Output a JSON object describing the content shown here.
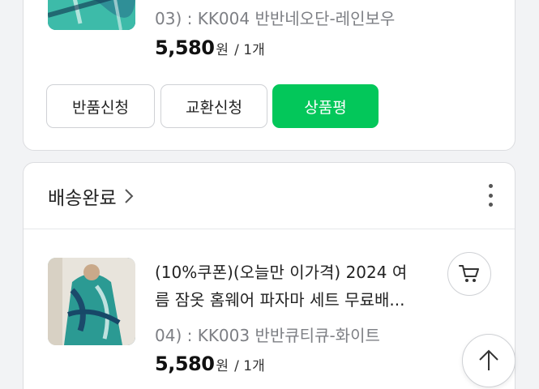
{
  "order_item_1": {
    "option": "03) : KK004 반반네오단-레인보우",
    "price": "5,580",
    "currency": "원",
    "quantity": "/ 1개",
    "buttons": {
      "return_label": "반품신청",
      "exchange_label": "교환신청",
      "review_label": "상품평"
    }
  },
  "order_item_2": {
    "status": "배송완료",
    "title_line1": "(10%쿠폰)(오늘만 이가격) 2024 여",
    "title_line2": "름 잠옷 홈웨어 파자마 세트 무료배...",
    "option": "04) : KK003 반반큐티큐-화이트",
    "price": "5,580",
    "currency": "원",
    "quantity": "/ 1개"
  },
  "icons": {
    "status_chevron": "chevron-right-icon",
    "more": "more-vertical-icon",
    "cart": "cart-icon",
    "scroll_top": "arrow-up-icon"
  },
  "colors": {
    "accent_green": "#03c75a",
    "background": "#f2f3f5"
  }
}
